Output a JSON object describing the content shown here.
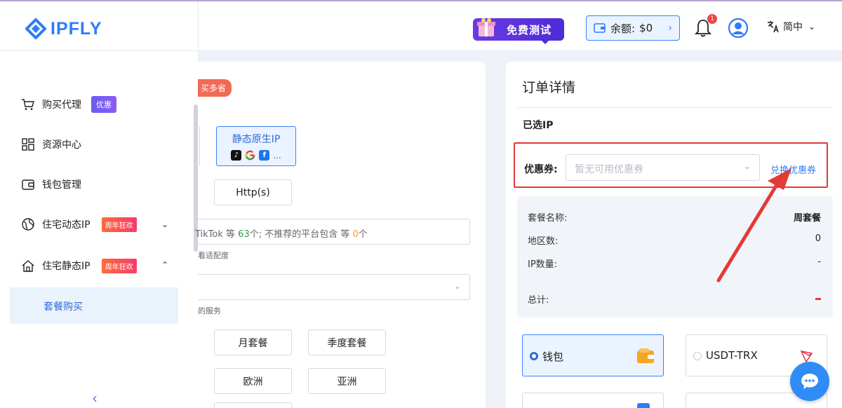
{
  "header": {
    "logo_text": "IPFLY",
    "trial_label": "免费测试",
    "balance_label": "余额:",
    "balance_value": "$0",
    "notification_count": "1",
    "language": "简中"
  },
  "sidebar": {
    "items": [
      {
        "label": "购买代理",
        "tag": "优惠"
      },
      {
        "label": "资源中心"
      },
      {
        "label": "钱包管理"
      },
      {
        "label": "住宅动态IP",
        "tag": "周年狂欢"
      },
      {
        "label": "住宅静态IP",
        "tag": "周年狂欢"
      }
    ],
    "sub_item": "套餐购买"
  },
  "main": {
    "promo_badge": "买多省",
    "static_ip_title": "静态原生IP",
    "more": "...",
    "protocol": "Http(s)",
    "platform_note": {
      "prefix": "TikTok 等 ",
      "recommended_count": "63",
      "middle": "个;  不推荐的平台包含 等 ",
      "not_recommended_count": "0",
      "suffix": "个"
    },
    "check_fit": "看适配度",
    "service_note": "的服务",
    "periods": [
      "月套餐",
      "季度套餐"
    ],
    "regions": [
      "欧洲",
      "亚洲"
    ]
  },
  "order": {
    "title": "订单详情",
    "selected_ip": "已选IP",
    "coupon_label": "优惠券:",
    "coupon_placeholder": "暂无可用优惠券",
    "redeem_link": "兑换优惠券",
    "summary": [
      {
        "label": "套餐名称:",
        "value": "周套餐"
      },
      {
        "label": "地区数:",
        "value": "0"
      },
      {
        "label": "IP数量:",
        "value": "-"
      },
      {
        "label": "总计:",
        "value": ""
      }
    ],
    "payments": [
      {
        "label": "钱包",
        "selected": true
      },
      {
        "label": "USDT-TRX",
        "selected": false
      }
    ]
  },
  "colors": {
    "brand": "#2f7cf6",
    "highlight": "#e53935",
    "promo": "#f06a55",
    "trial": "#5b32dd"
  }
}
